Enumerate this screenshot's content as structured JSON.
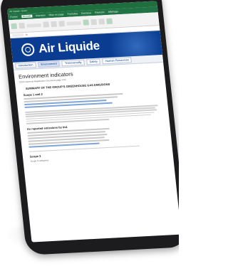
{
  "excel": {
    "title": "Air Liquide - Excel",
    "tabs": [
      "Fichier",
      "Accueil",
      "Insertion",
      "Mise en page",
      "Formules",
      "Données",
      "Révision",
      "Affichage"
    ],
    "cell_ref": "A1",
    "fx": "fx"
  },
  "brand": {
    "name": "Air Liquide"
  },
  "nav": {
    "items": [
      "Introduction",
      "Environment",
      "Transversally",
      "Safety",
      "Human Resources"
    ]
  },
  "doc": {
    "title": "Environment indicators",
    "subtitle": "2023 Universal Registration Document page XXX",
    "section": "SUMMARY OF THE GROUP'S GREENHOUSE GAS EMISSIONS",
    "scope12": "Scope 1 and 2",
    "as_reported": "As reported emissions by Ind.",
    "scope3": "Scope 3",
    "scope3_note": "Scope 3 categories"
  }
}
